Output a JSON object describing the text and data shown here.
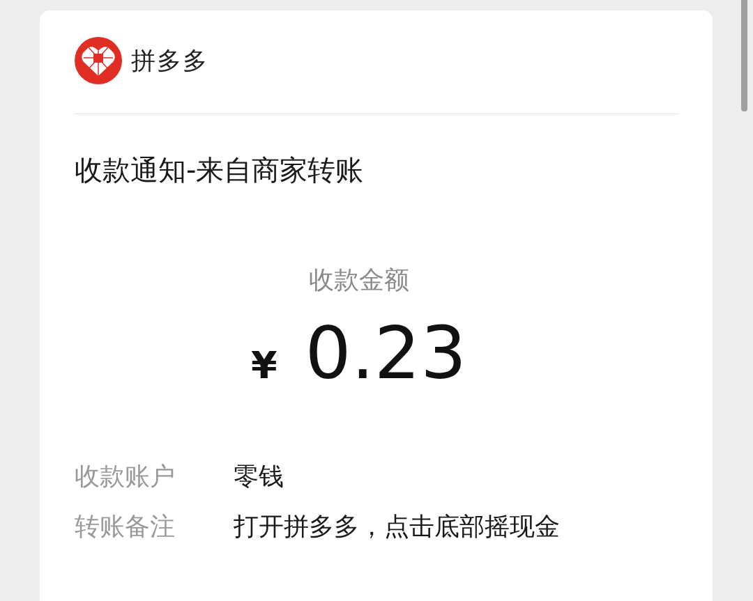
{
  "app": {
    "name": "拼多多"
  },
  "notice": {
    "title": "收款通知-来自商家转账",
    "amount_label": "收款金额",
    "currency": "¥",
    "amount": "0.23"
  },
  "details": [
    {
      "label": "收款账户",
      "value": "零钱"
    },
    {
      "label": "转账备注",
      "value": "打开拼多多，点击底部摇现金"
    }
  ]
}
